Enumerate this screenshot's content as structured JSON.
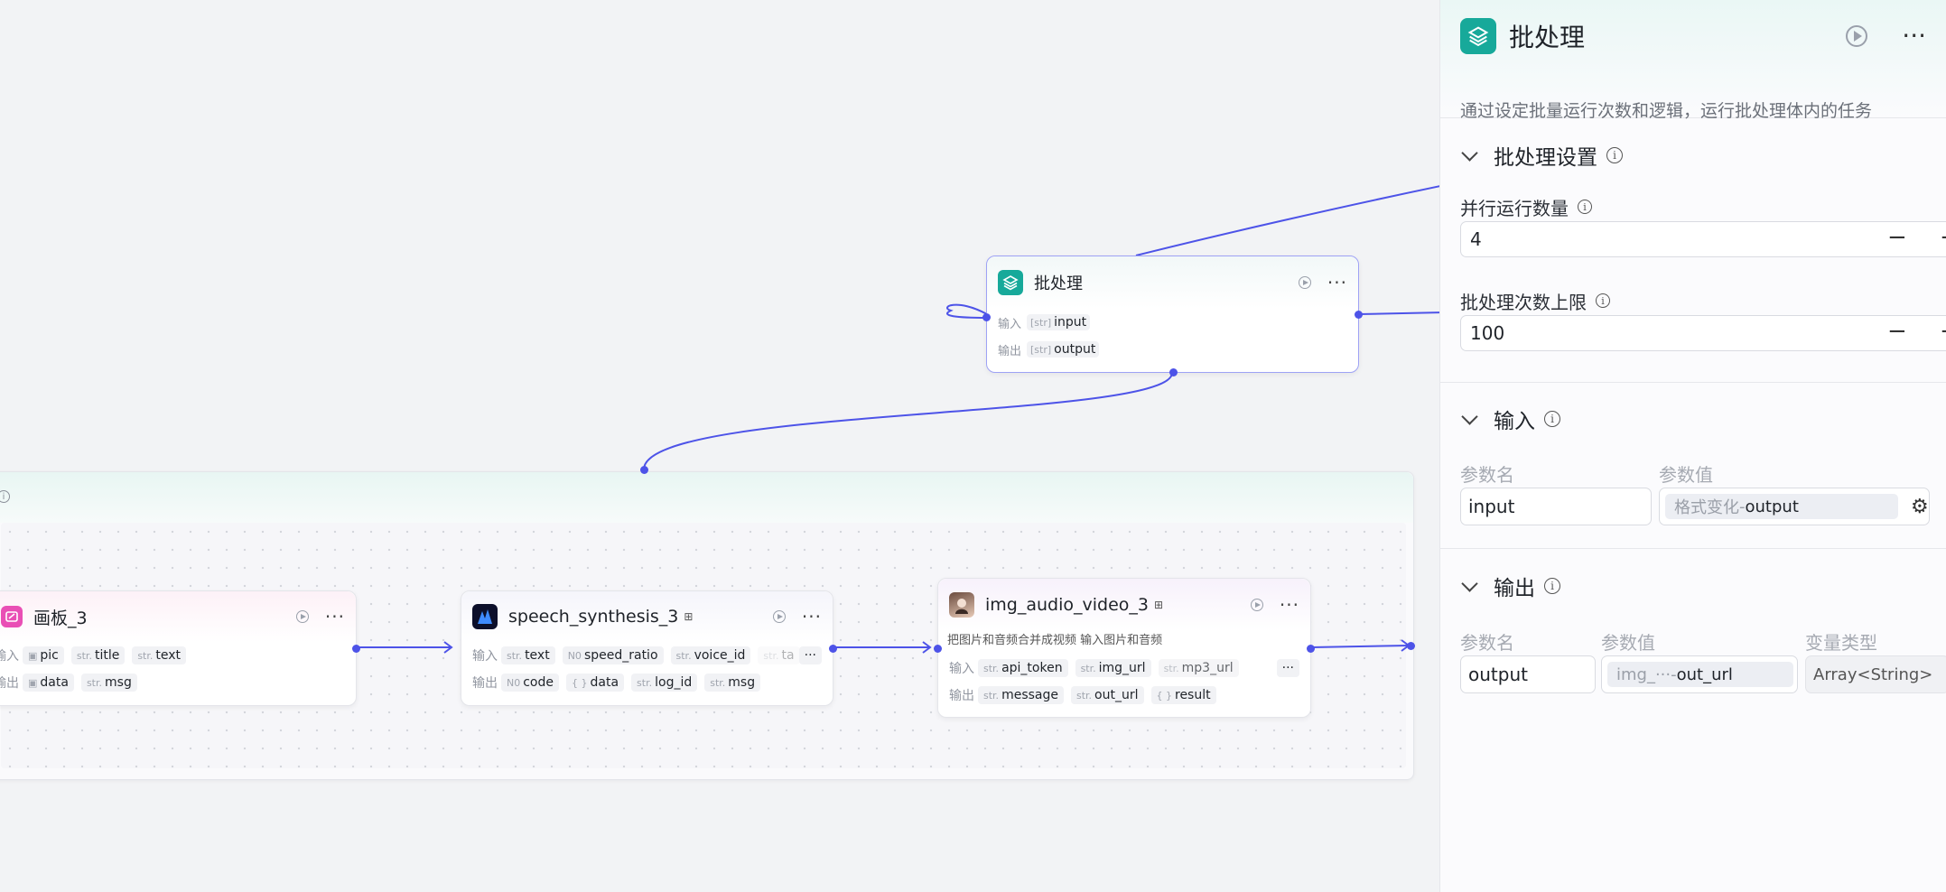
{
  "colors": {
    "accent": "#4d53e8",
    "batch_icon": "#17a99a",
    "canvas": "#f2f3f5"
  },
  "batch_node": {
    "title": "批处理",
    "in_label": "输入",
    "out_label": "输出",
    "input_type": "[str]",
    "input_name": "input",
    "output_type": "[str]",
    "output_name": "output"
  },
  "group": {
    "info": "i"
  },
  "nodes": [
    {
      "title": "画板_3",
      "icon": "paint-board-icon",
      "in_label": "输入",
      "out_label": "输出",
      "inputs": [
        {
          "type": "img",
          "name": "pic"
        },
        {
          "type": "str.",
          "name": "title"
        },
        {
          "type": "str.",
          "name": "text"
        }
      ],
      "outputs": [
        {
          "type": "img",
          "name": "data"
        },
        {
          "type": "str.",
          "name": "msg"
        }
      ]
    },
    {
      "title": "speech_synthesis_3",
      "icon": "speech-synthesis-icon",
      "in_label": "输入",
      "out_label": "输出",
      "more": "···",
      "inputs": [
        {
          "type": "str.",
          "name": "text"
        },
        {
          "type": "N0",
          "name": "speed_ratio"
        },
        {
          "type": "str.",
          "name": "voice_id"
        },
        {
          "type": "str.",
          "name": "ta"
        }
      ],
      "outputs": [
        {
          "type": "N0",
          "name": "code"
        },
        {
          "type": "{ }",
          "name": "data"
        },
        {
          "type": "str.",
          "name": "log_id"
        },
        {
          "type": "str.",
          "name": "msg"
        }
      ]
    },
    {
      "title": "img_audio_video_3",
      "icon": "avatar-icon",
      "desc": "把图片和音频合并成视频 输入图片和音频",
      "in_label": "输入",
      "out_label": "输出",
      "more": "···",
      "inputs": [
        {
          "type": "str.",
          "name": "api_token"
        },
        {
          "type": "str.",
          "name": "img_url"
        },
        {
          "type": "str.",
          "name": "mp3_url"
        }
      ],
      "outputs": [
        {
          "type": "str.",
          "name": "message"
        },
        {
          "type": "str.",
          "name": "out_url"
        },
        {
          "type": "{ }",
          "name": "result"
        }
      ]
    }
  ],
  "panel": {
    "title": "批处理",
    "desc": "通过设定批量运行次数和逻辑，运行批处理体内的任务",
    "settings": {
      "heading": "批处理设置",
      "parallel_label": "并行运行数量",
      "parallel_value": "4",
      "limit_label": "批处理次数上限",
      "limit_value": "100",
      "minus": "−",
      "plus": "+"
    },
    "input": {
      "heading": "输入",
      "col_name": "参数名",
      "col_value": "参数值",
      "param_name": "input",
      "ref_node": "格式变化",
      "ref_sep": " - ",
      "ref_field": "output"
    },
    "output": {
      "heading": "输出",
      "col_name": "参数名",
      "col_value": "参数值",
      "col_type": "变量类型",
      "param_name": "output",
      "ref_node": "img_···",
      "ref_sep": " - ",
      "ref_field": "out_url",
      "var_type": "Array<String>"
    }
  }
}
